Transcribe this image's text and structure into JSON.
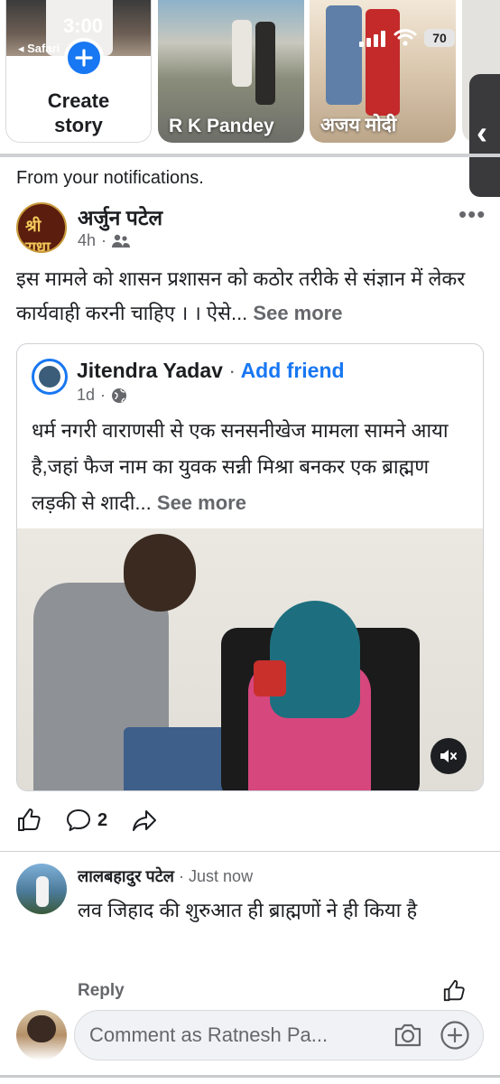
{
  "status_bar": {
    "time": "3:00",
    "back_label": "◂ Safari",
    "battery": "70"
  },
  "stories": {
    "create_label_line1": "Create",
    "create_label_line2": "story",
    "items": [
      {
        "name": "R K Pandey"
      },
      {
        "name": "अजय मोदी"
      }
    ]
  },
  "feed": {
    "section_label": "From your notifications.",
    "post": {
      "author": "अर्जुन पटेल",
      "time": "4h",
      "more_label": "•••",
      "text": "इस मामले को शासन प्रशासन को कठोर तरीके से संज्ञान में लेकर कार्यवाही करनी चाहिए । । ऐसे...",
      "see_more": "See more",
      "avatar_text": "श्री राधा",
      "shared": {
        "author": "Jitendra Yadav",
        "separator": "·",
        "add_friend": "Add friend",
        "time": "1d",
        "text": "धर्म नगरी वाराणसी से एक सनसनीखेज मामला सामने आया है,जहां फैज नाम का युवक सन्नी मिश्रा बनकर एक ब्राह्मण लड़की से शादी...",
        "see_more": "See more"
      },
      "actions": {
        "comment_count": "2"
      }
    },
    "comment": {
      "author": "लालबहादुर पटेल",
      "time": "Just now",
      "separator": "·",
      "text": "लव जिहाद की शुरुआत ही ब्राह्मणों ने ही किया है",
      "reply_label": "Reply"
    },
    "composer": {
      "placeholder": "Comment as Ratnesh Pa..."
    }
  },
  "colors": {
    "accent": "#1877f2",
    "secondary_text": "#65676b"
  }
}
